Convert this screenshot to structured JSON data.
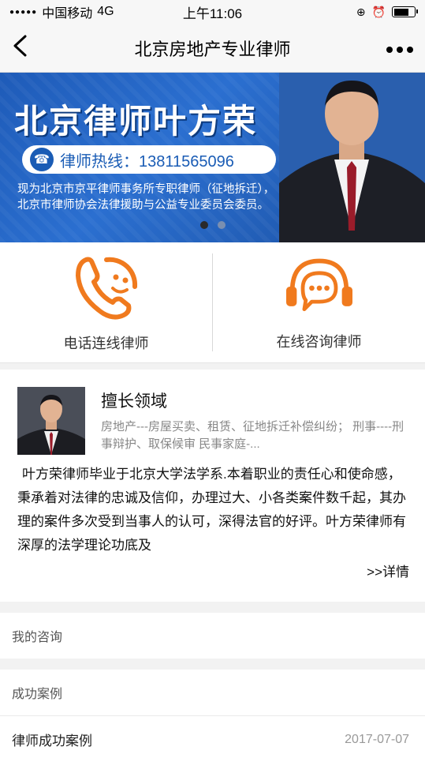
{
  "status": {
    "carrier": "中国移动",
    "network": "4G",
    "time": "上午11:06"
  },
  "nav": {
    "title": "北京房地产专业律师"
  },
  "banner": {
    "title": "北京律师叶方荣",
    "hotline": "律师热线：13811565096",
    "description": "现为北京市京平律师事务所专职律师（征地拆迁），北京市律师协会法律援助与公益专业委员会委员。"
  },
  "actions": [
    {
      "label": "电话连线律师",
      "icon": "phone-smile-icon",
      "color": "#f07a1e"
    },
    {
      "label": "在线咨询律师",
      "icon": "headset-chat-icon",
      "color": "#f07a1e"
    }
  ],
  "profile": {
    "expertise_title": "擅长领域",
    "expertise_text": "房地产---房屋买卖、租赁、征地拆迁补偿纠纷；   刑事----刑事辩护、取保候审 民事家庭-...",
    "bio": "叶方荣律师毕业于北京大学法学系.本着职业的责任心和使命感，秉承着对法律的忠诚及信仰，办理过大、小各类案件数千起，其办理的案件多次受到当事人的认可，深得法官的好评。叶方荣律师有深厚的法学理论功底及",
    "more": ">>详情"
  },
  "sections": {
    "my_consult": "我的咨询",
    "success_cases": "成功案例"
  },
  "case_list": [
    {
      "title": "律师成功案例",
      "date": "2017-07-07"
    }
  ]
}
